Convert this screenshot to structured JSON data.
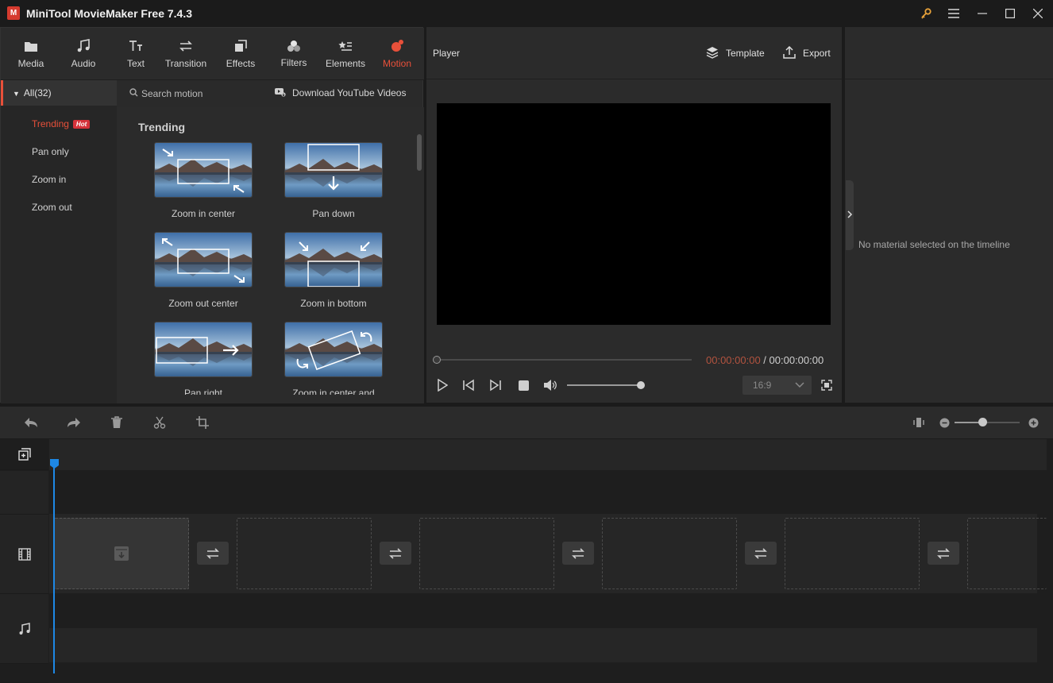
{
  "app": {
    "title": "MiniTool MovieMaker Free 7.4.3",
    "logo_letter": "M"
  },
  "toolbar": {
    "tabs": [
      {
        "label": "Media",
        "icon": "folder-icon"
      },
      {
        "label": "Audio",
        "icon": "music-note-icon"
      },
      {
        "label": "Text",
        "icon": "text-icon"
      },
      {
        "label": "Transition",
        "icon": "transition-icon"
      },
      {
        "label": "Effects",
        "icon": "effects-icon"
      },
      {
        "label": "Filters",
        "icon": "filters-icon"
      },
      {
        "label": "Elements",
        "icon": "elements-icon"
      },
      {
        "label": "Motion",
        "icon": "motion-icon"
      }
    ],
    "active_tab": "Motion"
  },
  "categories": {
    "all_label": "All(32)",
    "items": [
      "Trending",
      "Pan only",
      "Zoom in",
      "Zoom out"
    ],
    "hot_badge": "Hot"
  },
  "search": {
    "placeholder": "Search motion",
    "download_label": "Download YouTube Videos"
  },
  "content": {
    "section_title": "Trending",
    "motions": [
      {
        "label": "Zoom in center"
      },
      {
        "label": "Pan down"
      },
      {
        "label": "Zoom out center"
      },
      {
        "label": "Zoom in bottom"
      },
      {
        "label": "Pan right"
      },
      {
        "label": "Zoom in center and"
      }
    ]
  },
  "player": {
    "title": "Player",
    "template_label": "Template",
    "export_label": "Export",
    "current_time": "00:00:00:00",
    "separator": " / ",
    "total_time": "00:00:00:00",
    "aspect_ratio": "16:9"
  },
  "properties": {
    "empty_message": "No material selected on the timeline"
  },
  "colors": {
    "accent": "#e8503a",
    "playhead": "#1e88e5",
    "background": "#1b1b1b",
    "panel": "#2b2b2b"
  }
}
